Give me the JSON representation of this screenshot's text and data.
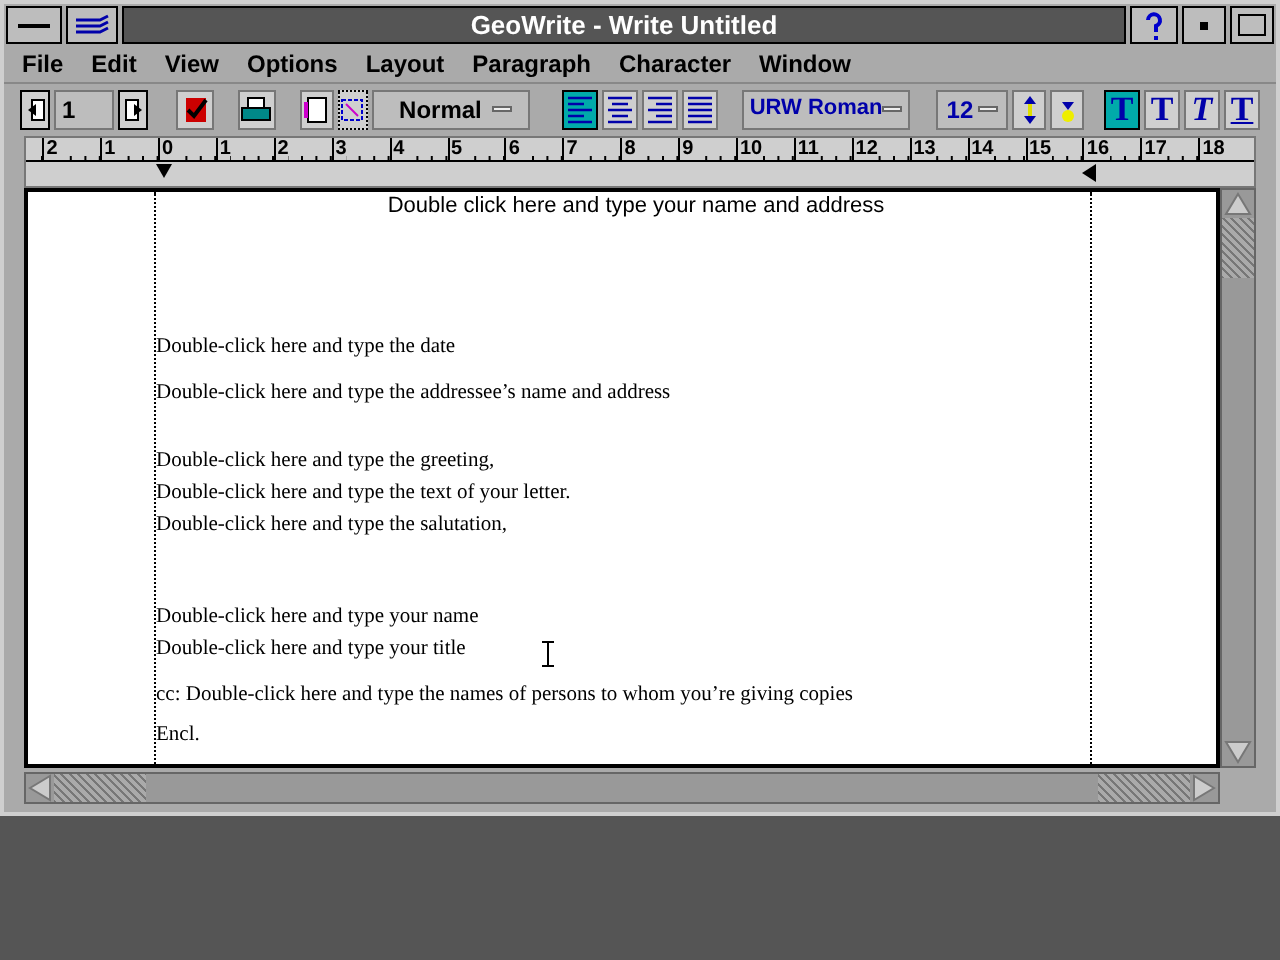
{
  "window": {
    "title": "GeoWrite - Write Untitled"
  },
  "menu": [
    "File",
    "Edit",
    "View",
    "Options",
    "Layout",
    "Paragraph",
    "Character",
    "Window"
  ],
  "toolbar": {
    "page": "1",
    "style": "Normal",
    "alignment": [
      {
        "kind": "left",
        "selected": true
      },
      {
        "kind": "center",
        "selected": false
      },
      {
        "kind": "right",
        "selected": false
      },
      {
        "kind": "justify",
        "selected": false
      }
    ],
    "font": "URW Roman",
    "size": "12",
    "text_styles": [
      {
        "label": "T",
        "kind": "plain",
        "selected": true
      },
      {
        "label": "T",
        "kind": "bold",
        "selected": false
      },
      {
        "label": "T",
        "kind": "italic",
        "selected": false
      },
      {
        "label": "T",
        "kind": "underline",
        "selected": false
      }
    ]
  },
  "ruler": [
    "2",
    "1",
    "0",
    "1",
    "2",
    "3",
    "4",
    "5",
    "6",
    "7",
    "8",
    "9",
    "10",
    "11",
    "12",
    "13",
    "14",
    "15",
    "16",
    "17",
    "18"
  ],
  "document": {
    "header": "Double click here and type your name and address",
    "lines": [
      "Double-click here and type the date",
      "Double-click here and type the addressee’s name and address",
      "Double-click here and type the greeting,",
      "Double-click here and type the text of your letter.",
      "Double-click here and type the salutation,",
      "Double-click here and type your name",
      "Double-click here and type your title",
      "cc:  Double-click here and type the names of persons to whom you’re giving copies",
      "Encl."
    ]
  }
}
